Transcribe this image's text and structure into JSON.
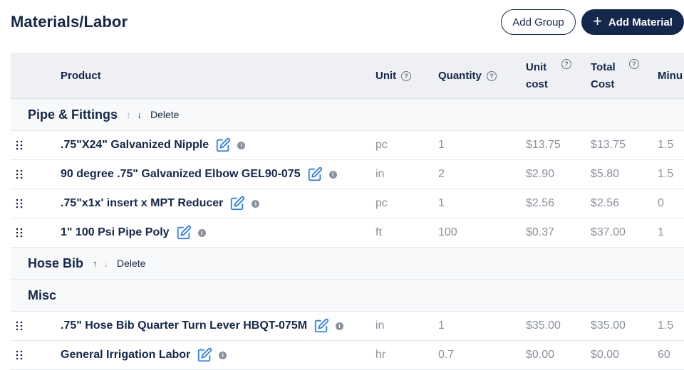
{
  "page": {
    "title": "Materials/Labor"
  },
  "actions": {
    "add_group": "Add Group",
    "add_material": "Add Material"
  },
  "columns": {
    "product": "Product",
    "unit": "Unit",
    "quantity": "Quantity",
    "unit_cost_1": "Unit",
    "unit_cost_2": "cost",
    "total_cost_1": "Total",
    "total_cost_2": "Cost",
    "minutes": "Minu"
  },
  "help_glyph": "?",
  "info_glyph": "i",
  "groups": [
    {
      "name": "Pipe & Fittings",
      "delete_label": "Delete"
    },
    {
      "name": "Hose Bib",
      "delete_label": "Delete"
    },
    {
      "name": "Misc"
    }
  ],
  "rows": [
    {
      "product": ".75\"X24\" Galvanized Nipple",
      "unit": "pc",
      "quantity": "1",
      "unit_cost": "$13.75",
      "total_cost": "$13.75",
      "minutes": "1.5"
    },
    {
      "product": "90 degree .75\" Galvanized Elbow GEL90-075",
      "unit": "in",
      "quantity": "2",
      "unit_cost": "$2.90",
      "total_cost": "$5.80",
      "minutes": "1.5"
    },
    {
      "product": ".75\"x1x' insert x MPT Reducer",
      "unit": "pc",
      "quantity": "1",
      "unit_cost": "$2.56",
      "total_cost": "$2.56",
      "minutes": "0"
    },
    {
      "product": "1\" 100 Psi Pipe Poly",
      "unit": "ft",
      "quantity": "100",
      "unit_cost": "$0.37",
      "total_cost": "$37.00",
      "minutes": "1"
    },
    {
      "product": ".75\" Hose Bib Quarter Turn Lever HBQT-075M",
      "unit": "in",
      "quantity": "1",
      "unit_cost": "$35.00",
      "total_cost": "$35.00",
      "minutes": "1.5"
    },
    {
      "product": "General Irrigation Labor",
      "unit": "hr",
      "quantity": "0.7",
      "unit_cost": "$0.00",
      "total_cost": "$0.00",
      "minutes": "60"
    }
  ],
  "colors": {
    "primary": "#14284b",
    "header_bg": "#eef0f4",
    "group_bg": "#f8f9fb",
    "edit_icon": "#2f80ed",
    "muted_text": "#8a919c"
  },
  "icons": {
    "drag": "drag-handle-icon",
    "edit": "edit-icon",
    "info": "info-icon",
    "help": "help-circle-icon",
    "up": "arrow-up-icon",
    "down": "arrow-down-icon",
    "plus": "plus-icon"
  }
}
